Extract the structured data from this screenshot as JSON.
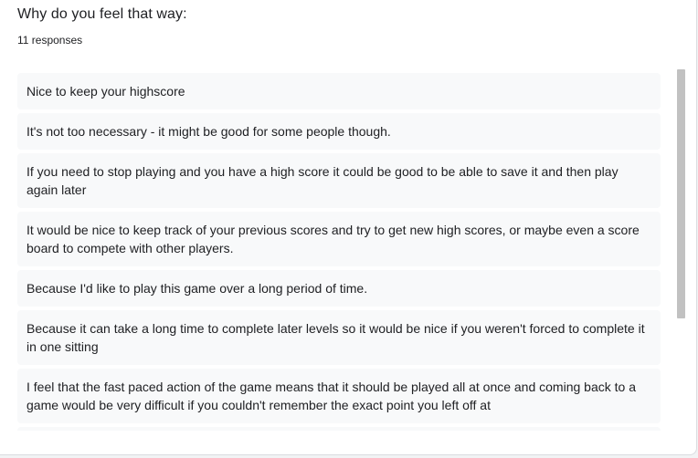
{
  "question": {
    "title": "Why do you feel that way:",
    "response_count": "11 responses"
  },
  "responses": [
    "Nice to keep your highscore",
    "It's not too necessary - it might be good for some people though.",
    "If you need to stop playing and you have a high score it could be good to be able to save it and then play again later",
    "It would be nice to keep track of your previous scores and try to get new high scores, or maybe even a score board to compete with other players.",
    "Because I'd like to play this game over a long period of time.",
    "Because it can take a long time to complete later levels so it would be nice if you weren't forced to complete it in one sitting",
    "I feel that the fast paced action of the game means that it should be played all at once and coming back to a game would be very difficult if you couldn't remember the exact point you left off at",
    ""
  ]
}
